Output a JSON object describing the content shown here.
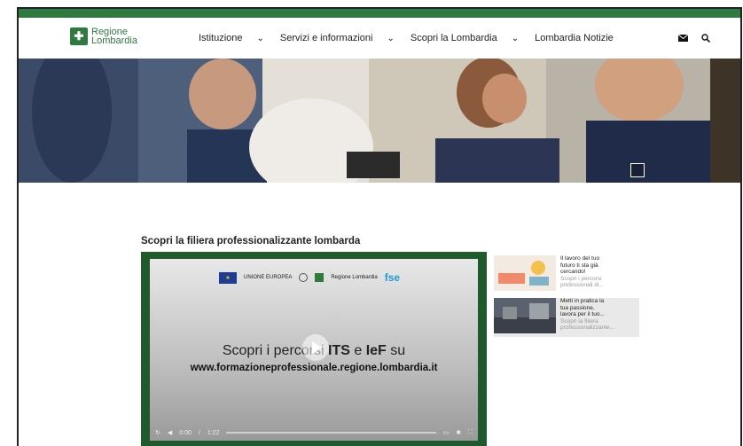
{
  "brand": {
    "color_green": "#2f7a3e",
    "logo_line1": "Regione",
    "logo_line2": "Lombardia"
  },
  "nav": {
    "items": [
      {
        "label": "Istituzione",
        "has_dropdown": true
      },
      {
        "label": "Servizi e informazioni",
        "has_dropdown": true
      },
      {
        "label": "Scopri la Lombardia",
        "has_dropdown": true
      },
      {
        "label": "Lombardia Notizie",
        "has_dropdown": false
      }
    ],
    "icons": [
      "mail-icon",
      "search-icon"
    ]
  },
  "hero": {
    "icon": "expand-icon"
  },
  "section": {
    "title": "Scopri la filiera professionalizzante lombarda"
  },
  "video": {
    "eu_label": "UNIONE EUROPEA",
    "regione_label": "Regione Lombardia",
    "fse_label": "fse",
    "line1_prefix": "Scopri i percorsi ",
    "line1_its": "ITS",
    "line1_mid": " e ",
    "line1_ief": "IeF",
    "line1_suffix": " su",
    "line2": "www.formazioneprofessionale.regione.lombardia.it",
    "time_current": "0:00",
    "time_total": "1:22"
  },
  "playlist": [
    {
      "title_1": "Il lavoro del tuo",
      "title_2": "futuro ti sta già",
      "title_3": "cercando!",
      "sub_1": "Scopri i percorsi",
      "sub_2": "professionali di..."
    },
    {
      "title_1": "Metti in pratica la",
      "title_2": "tua passione,",
      "title_3": "lavora per il tuo...",
      "sub_1": "Scopri la filiera",
      "sub_2": "professionalizzante..."
    }
  ]
}
